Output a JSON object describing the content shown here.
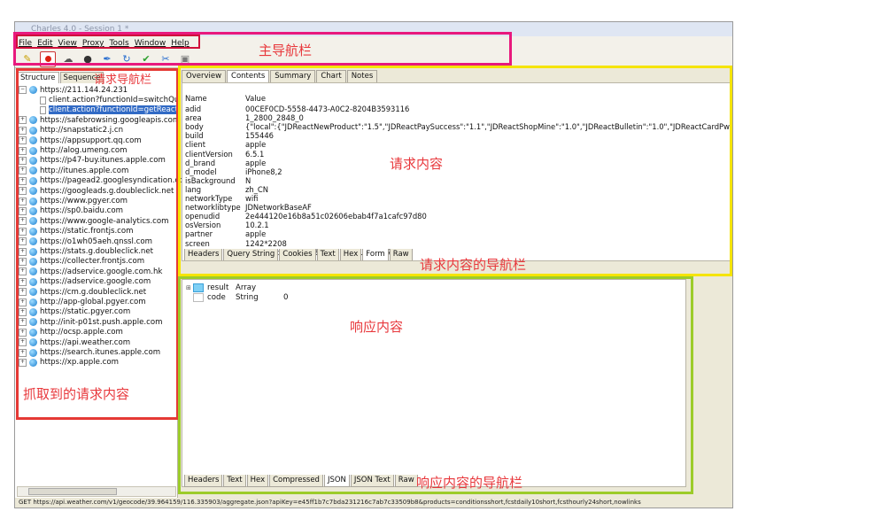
{
  "window": {
    "title": "Charles 4.0 - Session 1 *"
  },
  "menu": [
    "File",
    "Edit",
    "View",
    "Proxy",
    "Tools",
    "Window",
    "Help"
  ],
  "toolbar_icons": [
    "broom-icon",
    "record-icon",
    "throttle-turtle-icon",
    "breakpoint-icon",
    "pen-icon",
    "refresh-icon",
    "check-icon",
    "tools-icon",
    "settings-icon"
  ],
  "left": {
    "tabs": [
      "Structure",
      "Sequence"
    ],
    "tree": [
      {
        "type": "host",
        "expanded": true,
        "text": "https://211.144.24.231"
      },
      {
        "type": "child",
        "text": "client.action?functionId=switchQu"
      },
      {
        "type": "child",
        "selected": true,
        "text": "client.action?functionId=getReactI"
      },
      {
        "type": "host",
        "text": "https://safebrowsing.googleapis.com"
      },
      {
        "type": "host",
        "text": "http://snapstatic2.j.cn"
      },
      {
        "type": "host",
        "text": "https://appsupport.qq.com"
      },
      {
        "type": "host",
        "text": "http://alog.umeng.com"
      },
      {
        "type": "host",
        "text": "https://p47-buy.itunes.apple.com"
      },
      {
        "type": "host",
        "text": "http://itunes.apple.com"
      },
      {
        "type": "host",
        "text": "https://pagead2.googlesyndication.co"
      },
      {
        "type": "host",
        "text": "https://googleads.g.doubleclick.net"
      },
      {
        "type": "host",
        "text": "https://www.pgyer.com"
      },
      {
        "type": "host",
        "text": "https://sp0.baidu.com"
      },
      {
        "type": "host",
        "text": "https://www.google-analytics.com"
      },
      {
        "type": "host",
        "text": "https://static.frontjs.com"
      },
      {
        "type": "host",
        "text": "https://o1wh05aeh.qnssl.com"
      },
      {
        "type": "host",
        "text": "https://stats.g.doubleclick.net"
      },
      {
        "type": "host",
        "text": "https://collecter.frontjs.com"
      },
      {
        "type": "host",
        "text": "https://adservice.google.com.hk"
      },
      {
        "type": "host",
        "text": "https://adservice.google.com"
      },
      {
        "type": "host",
        "text": "https://cm.g.doubleclick.net"
      },
      {
        "type": "host",
        "text": "http://app-global.pgyer.com"
      },
      {
        "type": "host",
        "text": "https://static.pgyer.com"
      },
      {
        "type": "host",
        "text": "http://init-p01st.push.apple.com"
      },
      {
        "type": "host",
        "text": "http://ocsp.apple.com"
      },
      {
        "type": "host",
        "text": "https://api.weather.com"
      },
      {
        "type": "host",
        "text": "https://search.itunes.apple.com"
      },
      {
        "type": "host",
        "text": "https://xp.apple.com"
      }
    ]
  },
  "request": {
    "tabs": [
      "Overview",
      "Contents",
      "Summary",
      "Chart",
      "Notes"
    ],
    "active_tab": "Contents",
    "headers": [
      "Name",
      "Value"
    ],
    "rows": [
      [
        "adid",
        "00CEF0CD-5558-4473-A0C2-8204B3593116"
      ],
      [
        "area",
        "1_2800_2848_0"
      ],
      [
        "body",
        "{\"local\":{\"JDReactNewProduct\":\"1.5\",\"JDReactPaySuccess\":\"1.1\",\"JDReactShopMine\":\"1.0\",\"JDReactBulletin\":\"1.0\",\"JDReactCardPwd\":\"1.1\""
      ],
      [
        "build",
        "155446"
      ],
      [
        "client",
        "apple"
      ],
      [
        "clientVersion",
        "6.5.1"
      ],
      [
        "d_brand",
        "apple"
      ],
      [
        "d_model",
        "iPhone8,2"
      ],
      [
        "isBackground",
        "N"
      ],
      [
        "lang",
        "zh_CN"
      ],
      [
        "networkType",
        "wifi"
      ],
      [
        "networklibtype",
        "JDNetworkBaseAF"
      ],
      [
        "openudid",
        "2e444120e16b8a51c02606ebab4f7a1cafc97d80"
      ],
      [
        "osVersion",
        "10.2.1"
      ],
      [
        "partner",
        "apple"
      ],
      [
        "screen",
        "1242*2208"
      ],
      [
        "sign",
        "27ef872dee28d5d8672f6a6481678717"
      ]
    ],
    "bottom_tabs": [
      "Headers",
      "Query String",
      "Cookies",
      "Text",
      "Hex",
      "Form",
      "Raw"
    ],
    "bottom_active": "Form"
  },
  "response": {
    "tree": [
      {
        "expander": true,
        "icon": "folder-icon",
        "name": "result",
        "type": "Array",
        "value": ""
      },
      {
        "expander": false,
        "icon": "doc-icon",
        "name": "code",
        "type": "String",
        "value": "0"
      }
    ],
    "bottom_tabs": [
      "Headers",
      "Text",
      "Hex",
      "Compressed",
      "JSON",
      "JSON Text",
      "Raw"
    ],
    "bottom_active": "JSON"
  },
  "status": "GET https://api.weather.com/v1/geocode/39.964159/116.335903/aggregate.json?apiKey=e45ff1b7c7bda231216c7ab7c33509b8&products=conditionsshort,fcstdaily10short,fcsthourly24short,nowlinks",
  "annotations": {
    "menu": "主导航栏",
    "left_nav": "请求导航栏",
    "request_content": "请求内容",
    "request_nav": "请求内容的导航栏",
    "response_content": "响应内容",
    "captured": "抓取到的请求内容",
    "response_nav": "响应内容的导航栏"
  },
  "colors": {
    "menu_box": "#e8197d",
    "left_box": "#e53935",
    "request_box": "#f5e400",
    "response_box": "#9ccc2a",
    "annotation_text": "#e8383c",
    "selection": "#316ac5"
  }
}
